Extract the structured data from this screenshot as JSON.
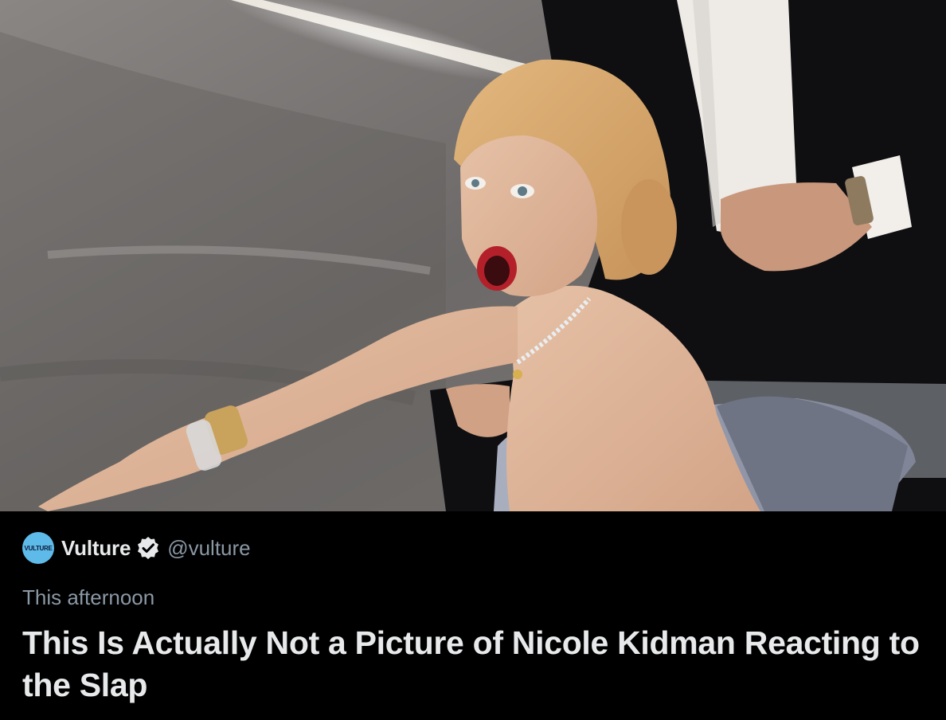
{
  "card": {
    "image_alt": "Nicole Kidman reacting at the Oscars"
  },
  "author": {
    "avatar_text": "VULTURE",
    "display_name": "Vulture",
    "handle": "@vulture",
    "verified_icon": "verified-badge-icon"
  },
  "timestamp": "This afternoon",
  "headline": "This Is Actually Not a Picture of Nicole Kidman Reacting to the Slap",
  "colors": {
    "background": "#000000",
    "primary_text": "#e7e9ea",
    "secondary_text": "#8b98a5",
    "avatar": "#5ebbe9"
  }
}
